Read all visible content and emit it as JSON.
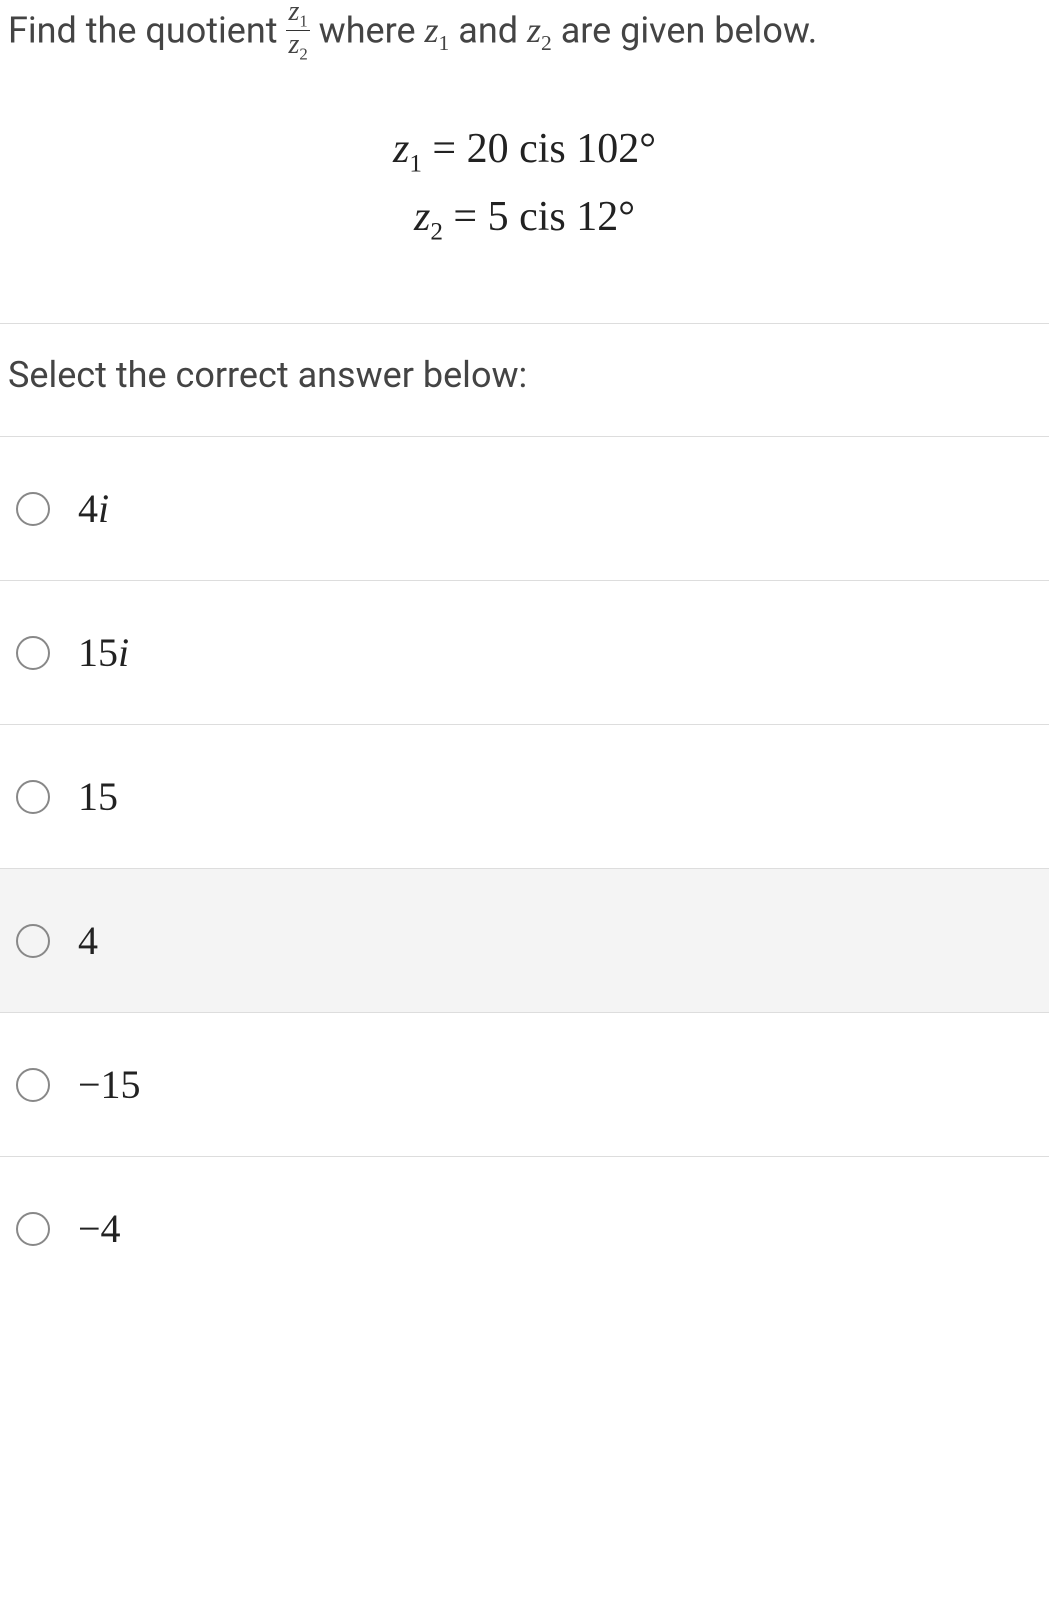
{
  "question": {
    "pre": "Find the quotient ",
    "frac_num": "z1",
    "frac_den": "z2",
    "mid": " where ",
    "var1": "z",
    "sub1": "1",
    "and_text": " and ",
    "var2": "z",
    "sub2": "2",
    "post": " are given below."
  },
  "equations": {
    "line1_lhs_var": "z",
    "line1_lhs_sub": "1",
    "line1_eq": " = ",
    "line1_rhs": "20 cis 102°",
    "line2_lhs_var": "z",
    "line2_lhs_sub": "2",
    "line2_eq": " = ",
    "line2_rhs": "5 cis 12°"
  },
  "prompt": "Select the correct answer below:",
  "options": [
    {
      "label_num": "4",
      "label_i": "i",
      "highlight": false
    },
    {
      "label_num": "15",
      "label_i": "i",
      "highlight": false
    },
    {
      "label_num": "15",
      "label_i": "",
      "highlight": false
    },
    {
      "label_num": "4",
      "label_i": "",
      "highlight": true
    },
    {
      "label_num": "−15",
      "label_i": "",
      "highlight": false
    },
    {
      "label_num": "−4",
      "label_i": "",
      "highlight": false
    }
  ]
}
